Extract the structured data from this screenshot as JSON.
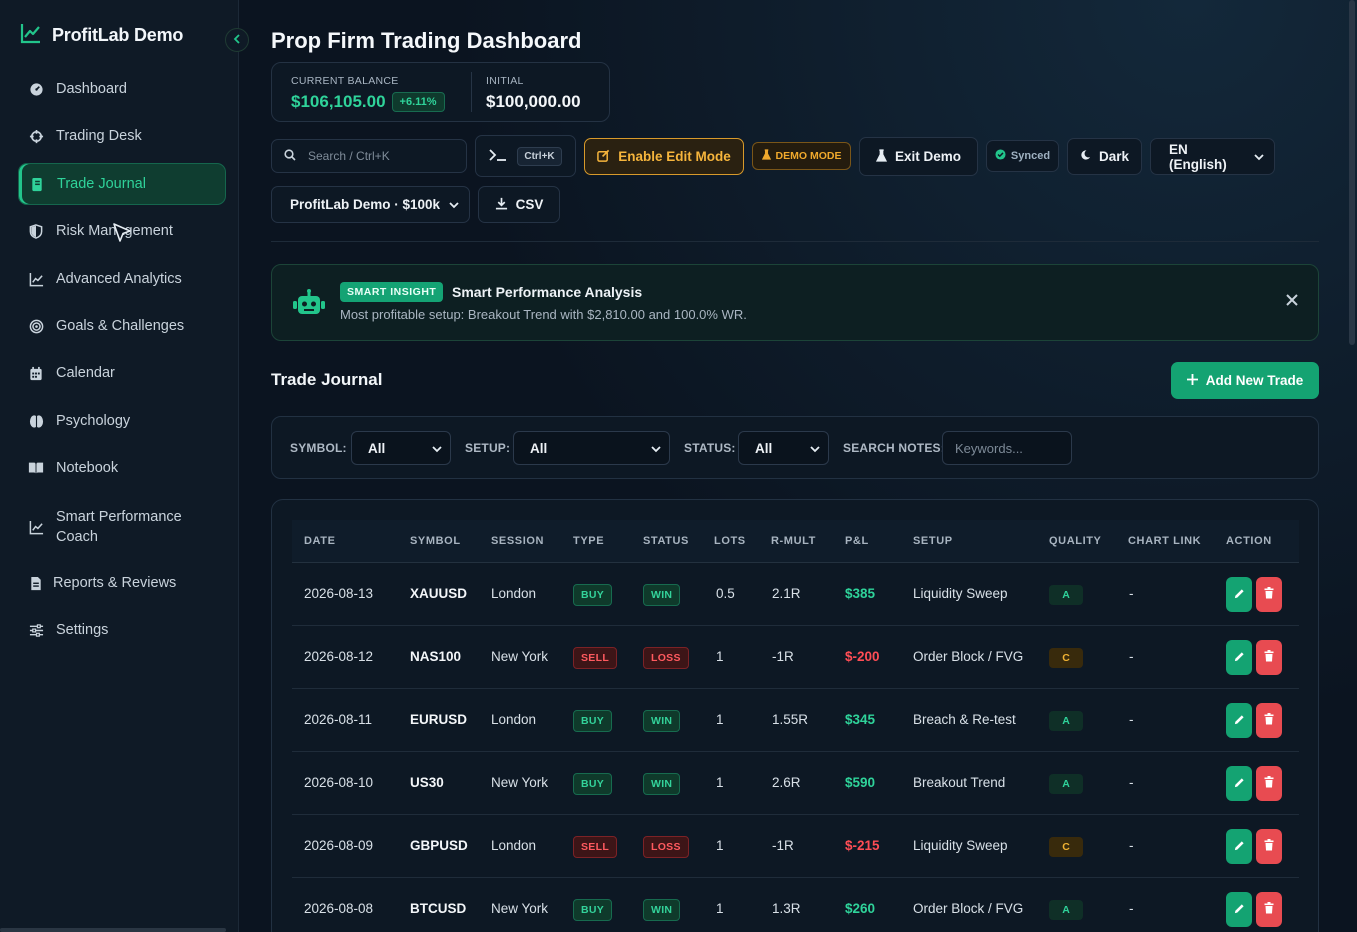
{
  "sidebar": {
    "brand": "ProfitLab Demo",
    "items": [
      {
        "label": "Dashboard",
        "icon": "gauge-icon"
      },
      {
        "label": "Trading Desk",
        "icon": "crosshair-icon"
      },
      {
        "label": "Trade Journal",
        "icon": "journal-icon"
      },
      {
        "label": "Risk Management",
        "icon": "shield-icon"
      },
      {
        "label": "Advanced Analytics",
        "icon": "line-chart-icon"
      },
      {
        "label": "Goals & Challenges",
        "icon": "target-icon"
      },
      {
        "label": "Calendar",
        "icon": "calendar-icon"
      },
      {
        "label": "Psychology",
        "icon": "brain-icon"
      },
      {
        "label": "Notebook",
        "icon": "book-icon"
      },
      {
        "label": "Smart Performance",
        "label2": "Coach",
        "icon": "trend-icon"
      },
      {
        "label": "Reports & Reviews",
        "icon": "report-icon"
      },
      {
        "label": "Settings",
        "icon": "sliders-icon"
      }
    ]
  },
  "header": {
    "title": "Prop Firm Trading Dashboard",
    "balance_label": "CURRENT BALANCE",
    "balance_value": "$106,105.00",
    "balance_change": "+6.11%",
    "initial_label": "INITIAL",
    "initial_value": "$100,000.00"
  },
  "toolbar": {
    "search_placeholder": "Search / Ctrl+K",
    "cmd_shortcut": "Ctrl+K",
    "edit_mode": "Enable Edit Mode",
    "demo_mode": "DEMO MODE",
    "exit_demo": "Exit Demo",
    "synced": "Synced",
    "theme": "Dark",
    "language": "EN (English)",
    "account": "ProfitLab Demo · $100k",
    "csv": "CSV"
  },
  "insight": {
    "tag": "SMART INSIGHT",
    "title": "Smart Performance Analysis",
    "text": "Most profitable setup: Breakout Trend with $2,810.00 and 100.0% WR."
  },
  "journal": {
    "title": "Trade Journal",
    "add_button": "Add New Trade",
    "filters": {
      "symbol_label": "SYMBOL:",
      "symbol_value": "All",
      "setup_label": "SETUP:",
      "setup_value": "All",
      "status_label": "STATUS:",
      "status_value": "All",
      "notes_label": "SEARCH NOTES:",
      "notes_placeholder": "Keywords..."
    },
    "columns": [
      "DATE",
      "SYMBOL",
      "SESSION",
      "TYPE",
      "STATUS",
      "LOTS",
      "R-MULT",
      "P&L",
      "SETUP",
      "QUALITY",
      "CHART LINK",
      "ACTION"
    ],
    "rows": [
      {
        "date": "2026-08-13",
        "symbol": "XAUUSD",
        "session": "London",
        "type": "BUY",
        "status": "WIN",
        "lots": "0.5",
        "r": "2.1R",
        "pnl": "$385",
        "setup": "Liquidity Sweep",
        "quality": "A",
        "chart": "-"
      },
      {
        "date": "2026-08-12",
        "symbol": "NAS100",
        "session": "New York",
        "type": "SELL",
        "status": "LOSS",
        "lots": "1",
        "r": "-1R",
        "pnl": "$-200",
        "setup": "Order Block / FVG",
        "quality": "C",
        "chart": "-"
      },
      {
        "date": "2026-08-11",
        "symbol": "EURUSD",
        "session": "London",
        "type": "BUY",
        "status": "WIN",
        "lots": "1",
        "r": "1.55R",
        "pnl": "$345",
        "setup": "Breach & Re-test",
        "quality": "A",
        "chart": "-"
      },
      {
        "date": "2026-08-10",
        "symbol": "US30",
        "session": "New York",
        "type": "BUY",
        "status": "WIN",
        "lots": "1",
        "r": "2.6R",
        "pnl": "$590",
        "setup": "Breakout Trend",
        "quality": "A",
        "chart": "-"
      },
      {
        "date": "2026-08-09",
        "symbol": "GBPUSD",
        "session": "London",
        "type": "SELL",
        "status": "LOSS",
        "lots": "1",
        "r": "-1R",
        "pnl": "$-215",
        "setup": "Liquidity Sweep",
        "quality": "C",
        "chart": "-"
      },
      {
        "date": "2026-08-08",
        "symbol": "BTCUSD",
        "session": "New York",
        "type": "BUY",
        "status": "WIN",
        "lots": "1",
        "r": "1.3R",
        "pnl": "$260",
        "setup": "Order Block / FVG",
        "quality": "A",
        "chart": "-"
      }
    ]
  },
  "colors": {
    "accent": "#14a372",
    "positive": "#2fd39a",
    "negative": "#ff4d55",
    "warning": "#f0a92c"
  }
}
